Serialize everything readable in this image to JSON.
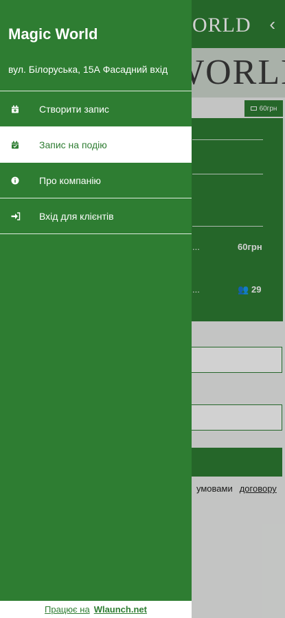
{
  "colors": {
    "brand": "#2e7d32",
    "active_bg": "#ffffff"
  },
  "background": {
    "header_title": "ORLD",
    "banner_text": "WORLD",
    "price_badge": "60грн",
    "card": {
      "row1_price": "60грн",
      "row2_count": "29",
      "ellipsis": "..."
    },
    "terms_text": "умовами",
    "terms_link": "договору"
  },
  "drawer": {
    "title": "Magic World",
    "address": "вул. Білоруська, 15А Фасадний вхід",
    "menu": [
      {
        "label": "Створити запис",
        "icon": "calendar-plus-icon",
        "active": false
      },
      {
        "label": "Запис на подію",
        "icon": "calendar-check-icon",
        "active": true
      },
      {
        "label": "Про компанію",
        "icon": "info-icon",
        "active": false
      },
      {
        "label": "Вхід для клієнтів",
        "icon": "sign-in-icon",
        "active": false
      }
    ],
    "footer": {
      "prefix": "Працює на",
      "brand": "Wlaunch.net"
    }
  }
}
